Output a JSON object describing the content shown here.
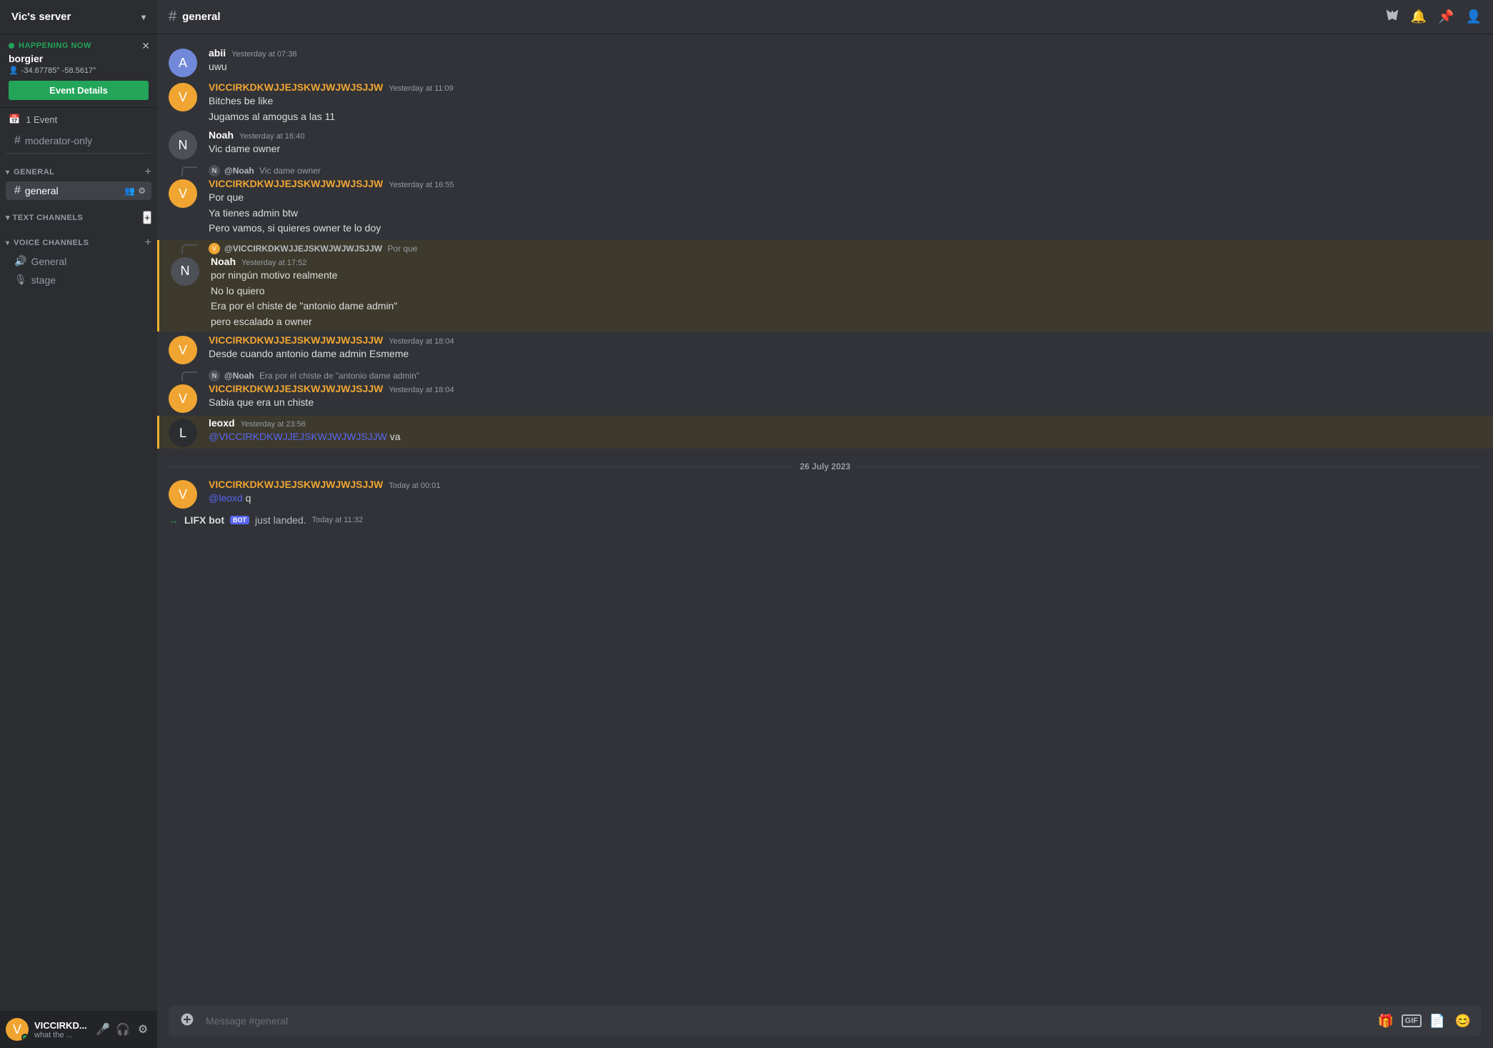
{
  "server": {
    "name": "Vic's server",
    "channel": "general"
  },
  "sidebar": {
    "happening_now_label": "HAPPENING NOW",
    "event_name": "borgier",
    "event_location": "-34.67785° -58.5617°",
    "event_details_btn": "Event Details",
    "events_label": "1 Event",
    "moderator_only": "moderator-only",
    "general_label": "GENERAL",
    "general_channel": "general",
    "text_channels_label": "TEXT CHANNELS",
    "voice_channels_label": "VOICE CHANNELS",
    "voice_general": "General",
    "voice_stage": "stage"
  },
  "user": {
    "name": "VICCIRKD...",
    "status": "what the ..."
  },
  "header": {
    "channel_name": "general",
    "hash_icon": "#"
  },
  "messages": [
    {
      "id": "msg1",
      "author": "abii",
      "author_color": "normal",
      "timestamp": "Yesterday at 07:38",
      "avatar_color": "#7289da",
      "lines": [
        "uwu"
      ],
      "reply_to": null
    },
    {
      "id": "msg2",
      "author": "VICCIRKDKWJJEJSKWJWJWJSJJW",
      "author_color": "vicc",
      "timestamp": "Yesterday at 11:09",
      "avatar_color": "#f0a532",
      "lines": [
        "Bitches be like",
        "Jugamos al amogus a las 11"
      ],
      "reply_to": null
    },
    {
      "id": "msg3",
      "author": "Noah",
      "author_color": "normal",
      "timestamp": "Yesterday at 16:40",
      "avatar_color": "#4e5058",
      "lines": [
        "Vic dame owner"
      ],
      "reply_to": null
    },
    {
      "id": "msg4",
      "author": "VICCIRKDKWJJEJSKWJWJWJSJJW",
      "author_color": "vicc",
      "timestamp": "Yesterday at 16:55",
      "avatar_color": "#f0a532",
      "lines": [
        "Por que",
        "Ya tienes admin btw",
        "Pero vamos, si quieres owner te lo doy"
      ],
      "reply_to": {
        "reply_author": "@Noah",
        "reply_text": "Vic dame owner",
        "reply_avatar_color": "#4e5058"
      }
    },
    {
      "id": "msg5",
      "author": "Noah",
      "author_color": "normal",
      "timestamp": "Yesterday at 17:52",
      "avatar_color": "#4e5058",
      "lines": [
        "por ningún motivo realmente",
        "No lo quiero",
        "Era por el chiste de \"antonio dame admin\"",
        "pero escalado a owner"
      ],
      "highlighted": true,
      "reply_to": {
        "reply_author": "@VICCIRKDKWJJEJSKWJWJWJSJJW",
        "reply_text": "Por que",
        "reply_avatar_color": "#f0a532"
      }
    },
    {
      "id": "msg6",
      "author": "VICCIRKDKWJJEJSKWJWJWJSJJW",
      "author_color": "vicc",
      "timestamp": "Yesterday at 18:04",
      "avatar_color": "#f0a532",
      "lines": [
        "Desde cuando antonio dame admin Esmeme"
      ],
      "reply_to": null
    },
    {
      "id": "msg7",
      "author": "VICCIRKDKWJJEJSKWJWJWJSJJW",
      "author_color": "vicc",
      "timestamp": "Yesterday at 18:04",
      "avatar_color": "#f0a532",
      "lines": [
        "Sabia que era un chiste"
      ],
      "reply_to": {
        "reply_author": "@Noah",
        "reply_text": "Era por el chiste de \"antonio dame admin\"",
        "reply_avatar_color": "#4e5058"
      }
    },
    {
      "id": "msg8",
      "author": "leoxd",
      "author_color": "normal",
      "timestamp": "Yesterday at 23:56",
      "avatar_color": "#2b2d31",
      "lines": [
        "va"
      ],
      "mention": "@VICCIRKDKWJJEJSKWJWJWJSJJW",
      "highlighted": true,
      "reply_to": null
    }
  ],
  "date_divider": "26 July 2023",
  "messages_after_divider": [
    {
      "id": "msg9",
      "author": "VICCIRKDKWJJEJSKWJWJWJSJJW",
      "author_color": "vicc",
      "timestamp": "Today at 00:01",
      "avatar_color": "#f0a532",
      "lines": [
        "q"
      ],
      "mention": "@leoxd",
      "reply_to": null
    },
    {
      "id": "msg10",
      "bot": true,
      "bot_name": "LIFX bot",
      "bot_text": "just landed.",
      "timestamp": "Today at 11:32"
    }
  ],
  "input": {
    "placeholder": "Message #general"
  }
}
